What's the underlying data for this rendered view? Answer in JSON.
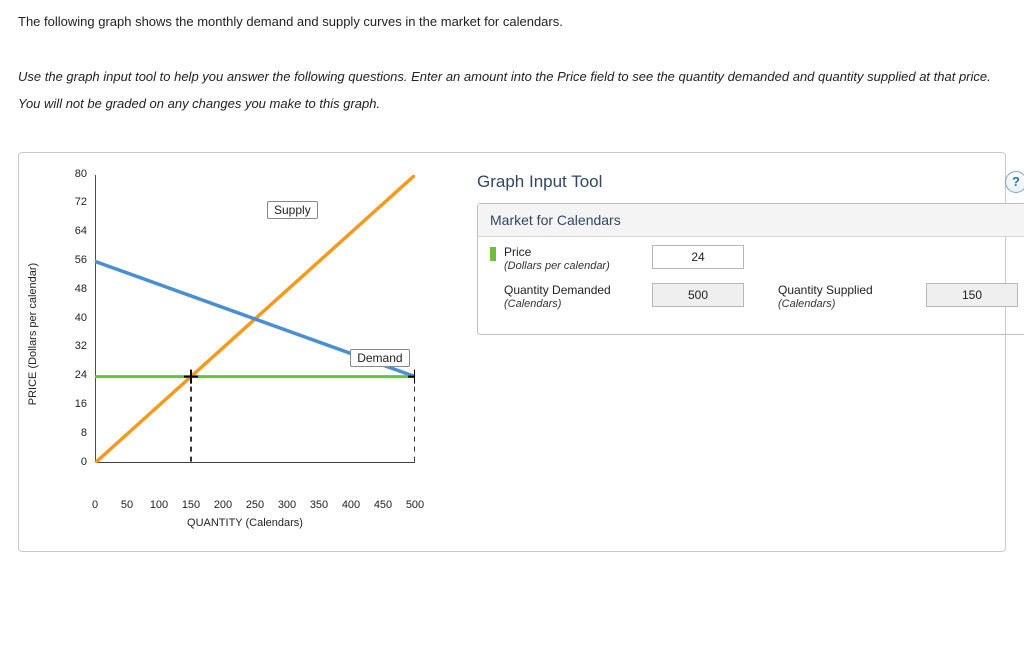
{
  "intro1": "The following graph shows the monthly demand and supply curves in the market for calendars.",
  "intro2": "Use the graph input tool to help you answer the following questions. Enter an amount into the Price field to see the quantity demanded and quantity supplied at that price. You will not be graded on any changes you make to this graph.",
  "tool": {
    "title": "Graph Input Tool",
    "section": "Market for Calendars",
    "price_label": "Price",
    "price_sub": "(Dollars per calendar)",
    "price_value": "24",
    "qd_label": "Quantity Demanded",
    "qd_sub": "(Calendars)",
    "qd_value": "500",
    "qs_label": "Quantity Supplied",
    "qs_sub": "(Calendars)",
    "qs_value": "150",
    "help": "?"
  },
  "chart_data": {
    "type": "line",
    "title": "",
    "xlabel": "QUANTITY (Calendars)",
    "ylabel": "PRICE (Dollars per calendar)",
    "xlim": [
      0,
      500
    ],
    "ylim": [
      0,
      80
    ],
    "xtick": [
      0,
      50,
      100,
      150,
      200,
      250,
      300,
      350,
      400,
      450,
      500
    ],
    "ytick": [
      0,
      8,
      16,
      24,
      32,
      40,
      48,
      56,
      64,
      72,
      80
    ],
    "series": [
      {
        "name": "Supply",
        "color": "#f39a1f",
        "x": [
          0,
          500
        ],
        "y": [
          0,
          80
        ]
      },
      {
        "name": "Demand",
        "color": "#4a8fd3",
        "x": [
          0,
          500
        ],
        "y": [
          56,
          24
        ]
      }
    ],
    "indicator": {
      "price": 24,
      "qd": 500,
      "qs": 150,
      "color": "#6cbf3b"
    },
    "labels": {
      "supply": "Supply",
      "demand": "Demand"
    }
  }
}
